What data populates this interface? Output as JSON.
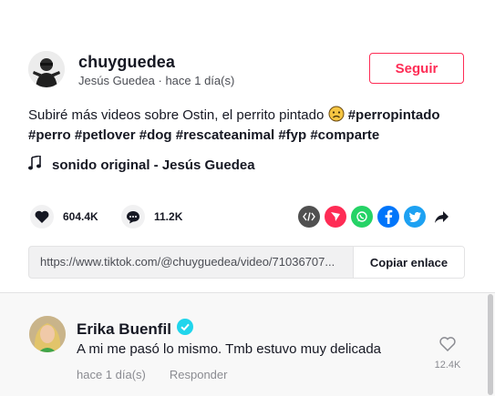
{
  "author": {
    "username": "chuyguedea",
    "display_name": "Jesús Guedea",
    "time": "hace 1 día(s)",
    "separator": "·"
  },
  "follow_label": "Seguir",
  "description": {
    "text": "Subiré más videos sobre Ostin, el perrito pintado",
    "hashtags": [
      "#perropintado",
      "#perro",
      "#petlover",
      "#dog",
      "#rescateanimal",
      "#fyp",
      "#comparte"
    ]
  },
  "music": "sonido original - Jesús Guedea",
  "stats": {
    "likes": "604.4K",
    "comments": "11.2K"
  },
  "share": [
    {
      "icon": "embed-code-icon",
      "color": "#505050"
    },
    {
      "icon": "send-to-friends-icon",
      "color": "#fe2c55"
    },
    {
      "icon": "whatsapp-icon",
      "color": "#25d366"
    },
    {
      "icon": "facebook-icon",
      "color": "#0075fa"
    },
    {
      "icon": "twitter-icon",
      "color": "#1da1f2"
    },
    {
      "icon": "share-arrow-icon",
      "color": "#161823"
    }
  ],
  "link": {
    "url": "https://www.tiktok.com/@chuyguedea/video/71036707...",
    "copy_label": "Copiar enlace"
  },
  "comment": {
    "author": "Erika Buenfil",
    "verified": true,
    "text": "A mi me pasó lo mismo. Tmb estuvo muy delicada",
    "time": "hace 1 día(s)",
    "reply_label": "Responder",
    "likes": "12.4K"
  },
  "colors": {
    "accent": "#fe2c55",
    "verified": "#20d5ec",
    "text": "#161823",
    "muted": "#8a8b91"
  }
}
